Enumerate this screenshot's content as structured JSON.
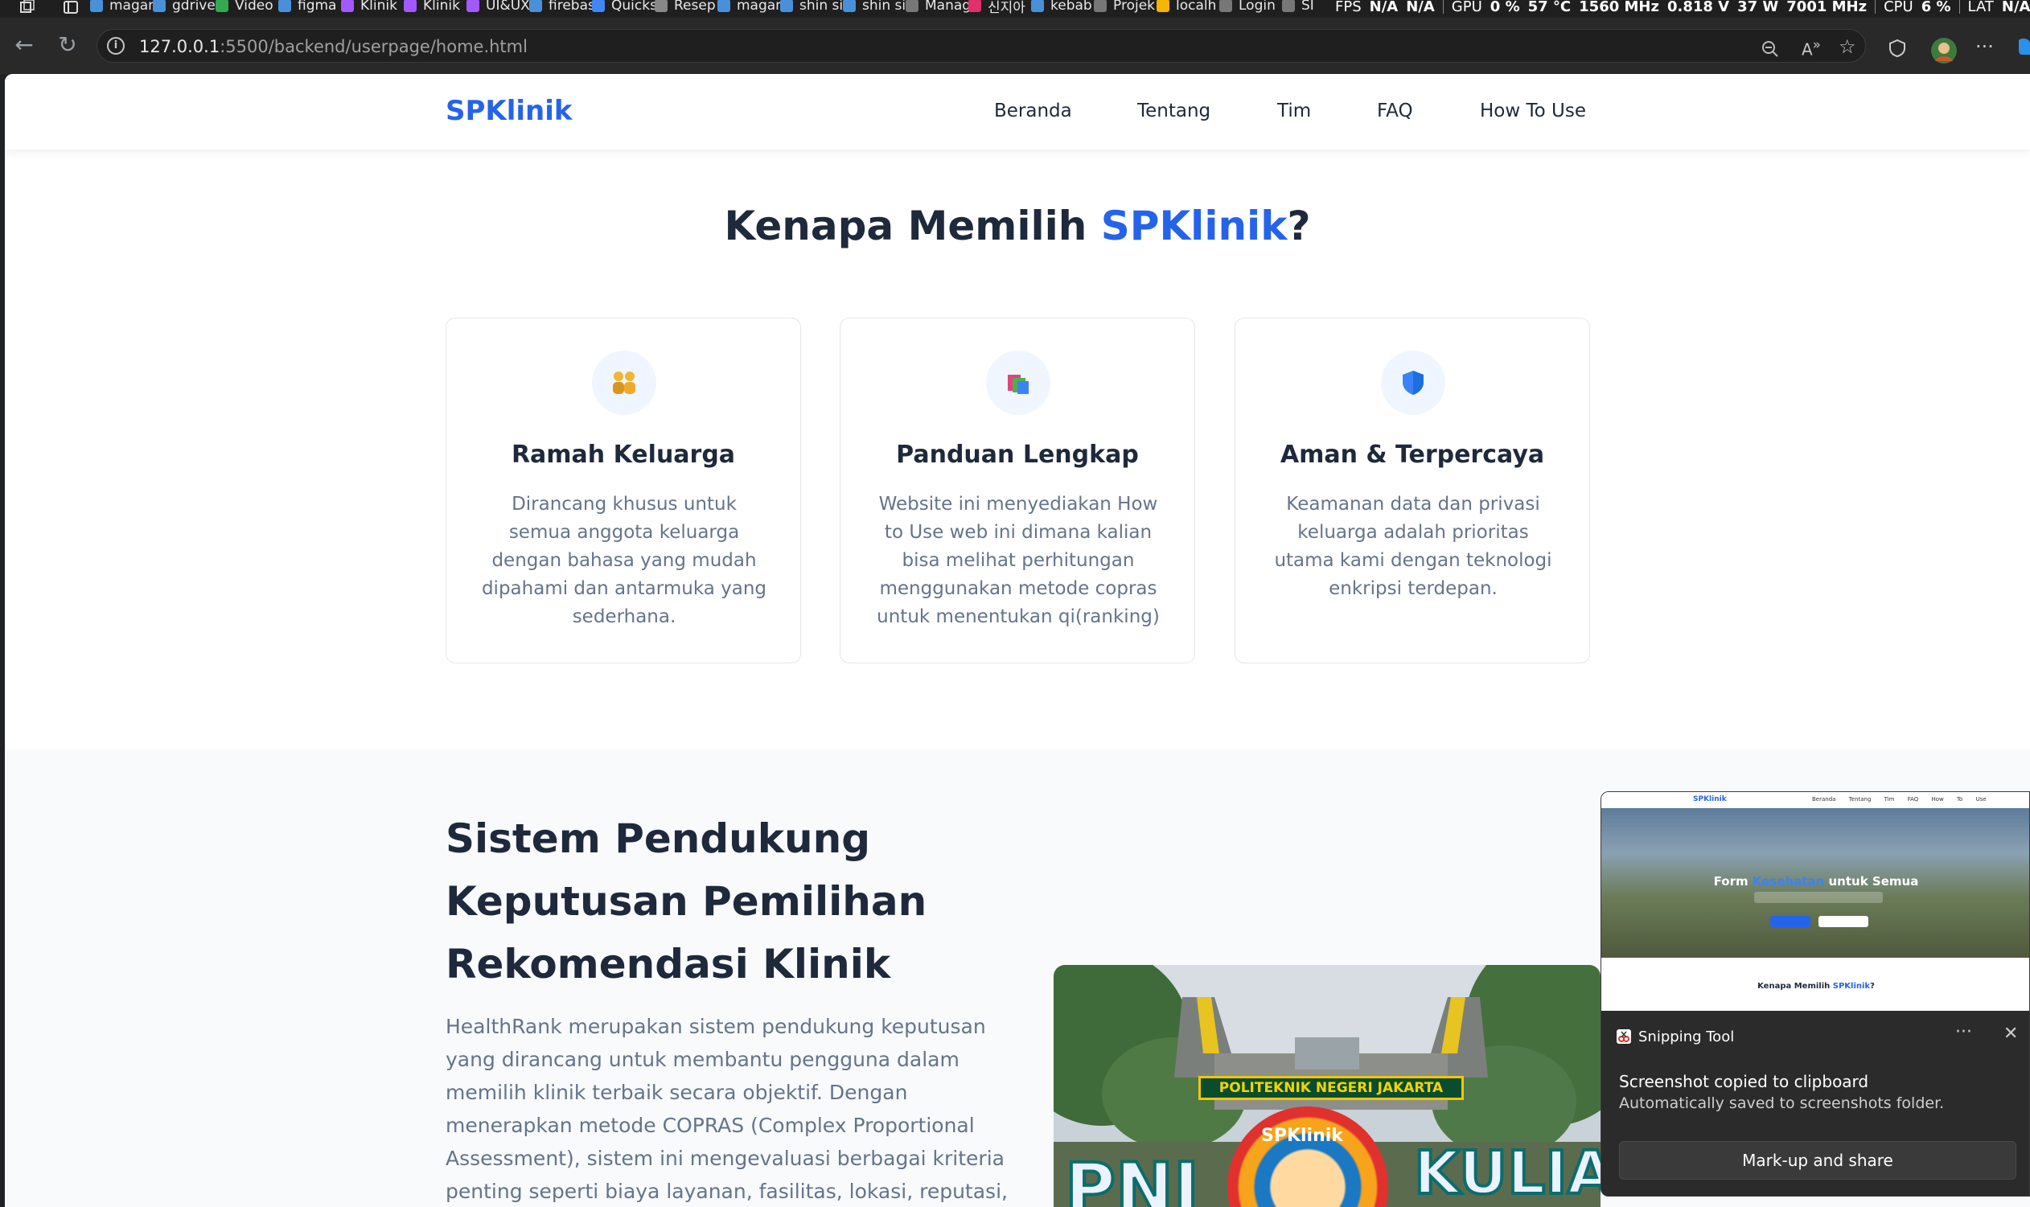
{
  "os_tabs": [
    {
      "label": "magan",
      "icon": "search-icon"
    },
    {
      "label": "gdrive",
      "icon": "search-icon"
    },
    {
      "label": "Video",
      "icon": "google-drive-icon"
    },
    {
      "label": "figma",
      "icon": "search-icon"
    },
    {
      "label": "Klinik",
      "icon": "figma-icon"
    },
    {
      "label": "Klinik",
      "icon": "figma-icon"
    },
    {
      "label": "UI&UX",
      "icon": "figma-icon"
    },
    {
      "label": "firebas",
      "icon": "search-icon"
    },
    {
      "label": "Quicks",
      "icon": "google-cloud-icon"
    },
    {
      "label": "Resep",
      "icon": "openai-icon"
    },
    {
      "label": "magan",
      "icon": "search-icon"
    },
    {
      "label": "shin si",
      "icon": "search-icon"
    },
    {
      "label": "shin si",
      "icon": "search-icon"
    },
    {
      "label": "Manag",
      "icon": "globe-icon"
    },
    {
      "label": "신지아",
      "icon": "instagram-icon"
    },
    {
      "label": "kebab",
      "icon": "search-icon"
    },
    {
      "label": "Projek",
      "icon": "globe-icon"
    },
    {
      "label": "localh",
      "icon": "warning-icon"
    },
    {
      "label": "Login",
      "icon": "globe-icon"
    },
    {
      "label": "SI",
      "icon": "globe-icon"
    }
  ],
  "hud": {
    "fps_label": "FPS",
    "fps_value": "N/A",
    "fps_value2": "N/A",
    "gpu_label": "GPU",
    "gpu_load": "0 %",
    "gpu_temp": "57 °C",
    "gpu_clock": "1560 MHz",
    "gpu_volt": "0.818 V",
    "gpu_power": "37 W",
    "gpu_mem": "7001 MHz",
    "cpu_label": "CPU",
    "cpu_load": "6 %",
    "lat_label": "LAT",
    "lat_value": "N/A",
    "lat_value2": "N"
  },
  "browser": {
    "url_host": "127.0.0.1",
    "url_path": ":5500/backend/userpage/home.html"
  },
  "site": {
    "brand": "SPKlinik",
    "nav": [
      "Beranda",
      "Tentang",
      "Tim",
      "FAQ",
      "How To Use"
    ],
    "why_title_prefix": "Kenapa Memilih ",
    "why_title_accent": "SPKlinik",
    "why_title_suffix": "?",
    "features": [
      {
        "icon": "family-icon",
        "title": "Ramah Keluarga",
        "text": "Dirancang khusus untuk semua anggota keluarga dengan bahasa yang mudah dipahami dan antarmuka yang sederhana."
      },
      {
        "icon": "books-icon",
        "title": "Panduan Lengkap",
        "text": "Website ini menyediakan How to Use web ini dimana kalian bisa melihat perhitungan menggunakan metode copras untuk menentukan qi(ranking)"
      },
      {
        "icon": "shield-icon",
        "title": "Aman & Terpercaya",
        "text": "Keamanan data dan privasi keluarga adalah prioritas utama kami dengan teknologi enkripsi terdepan."
      }
    ],
    "about_title": "Sistem Pendukung Keputusan Pemilihan Rekomendasi Klinik",
    "about_text": "HealthRank merupakan sistem pendukung keputusan yang dirancang untuk membantu pengguna dalam memilih klinik terbaik secara objektif. Dengan menerapkan metode COPRAS (Complex Proportional Assessment), sistem ini mengevaluasi berbagai kriteria penting seperti biaya layanan, fasilitas, lokasi, reputasi,",
    "campus_sign": "POLITEKNIK NEGERI JAKARTA",
    "campus_sticker_left": "PNJ",
    "campus_sticker_right": "KULIAH",
    "campus_badge": "SPKlinik"
  },
  "snip": {
    "thumb_brand": "SPKlinik",
    "thumb_nav": "Beranda Tentang Tim FAQ How To Use",
    "thumb_hero_prefix": "Form ",
    "thumb_hero_accent": "Kesehatan",
    "thumb_hero_suffix": " untuk Semua",
    "thumb_kenapa_prefix": "Kenapa Memilih ",
    "thumb_kenapa_accent": "SPKlinik",
    "thumb_kenapa_suffix": "?",
    "app_name": "Snipping Tool",
    "more": "···",
    "close": "✕",
    "message": "Screenshot copied to clipboard",
    "detail": "Automatically saved to screenshots folder.",
    "button": "Mark-up and share"
  },
  "colors": {
    "accent": "#2563eb",
    "heading": "#1e293b",
    "muted": "#64748b"
  }
}
